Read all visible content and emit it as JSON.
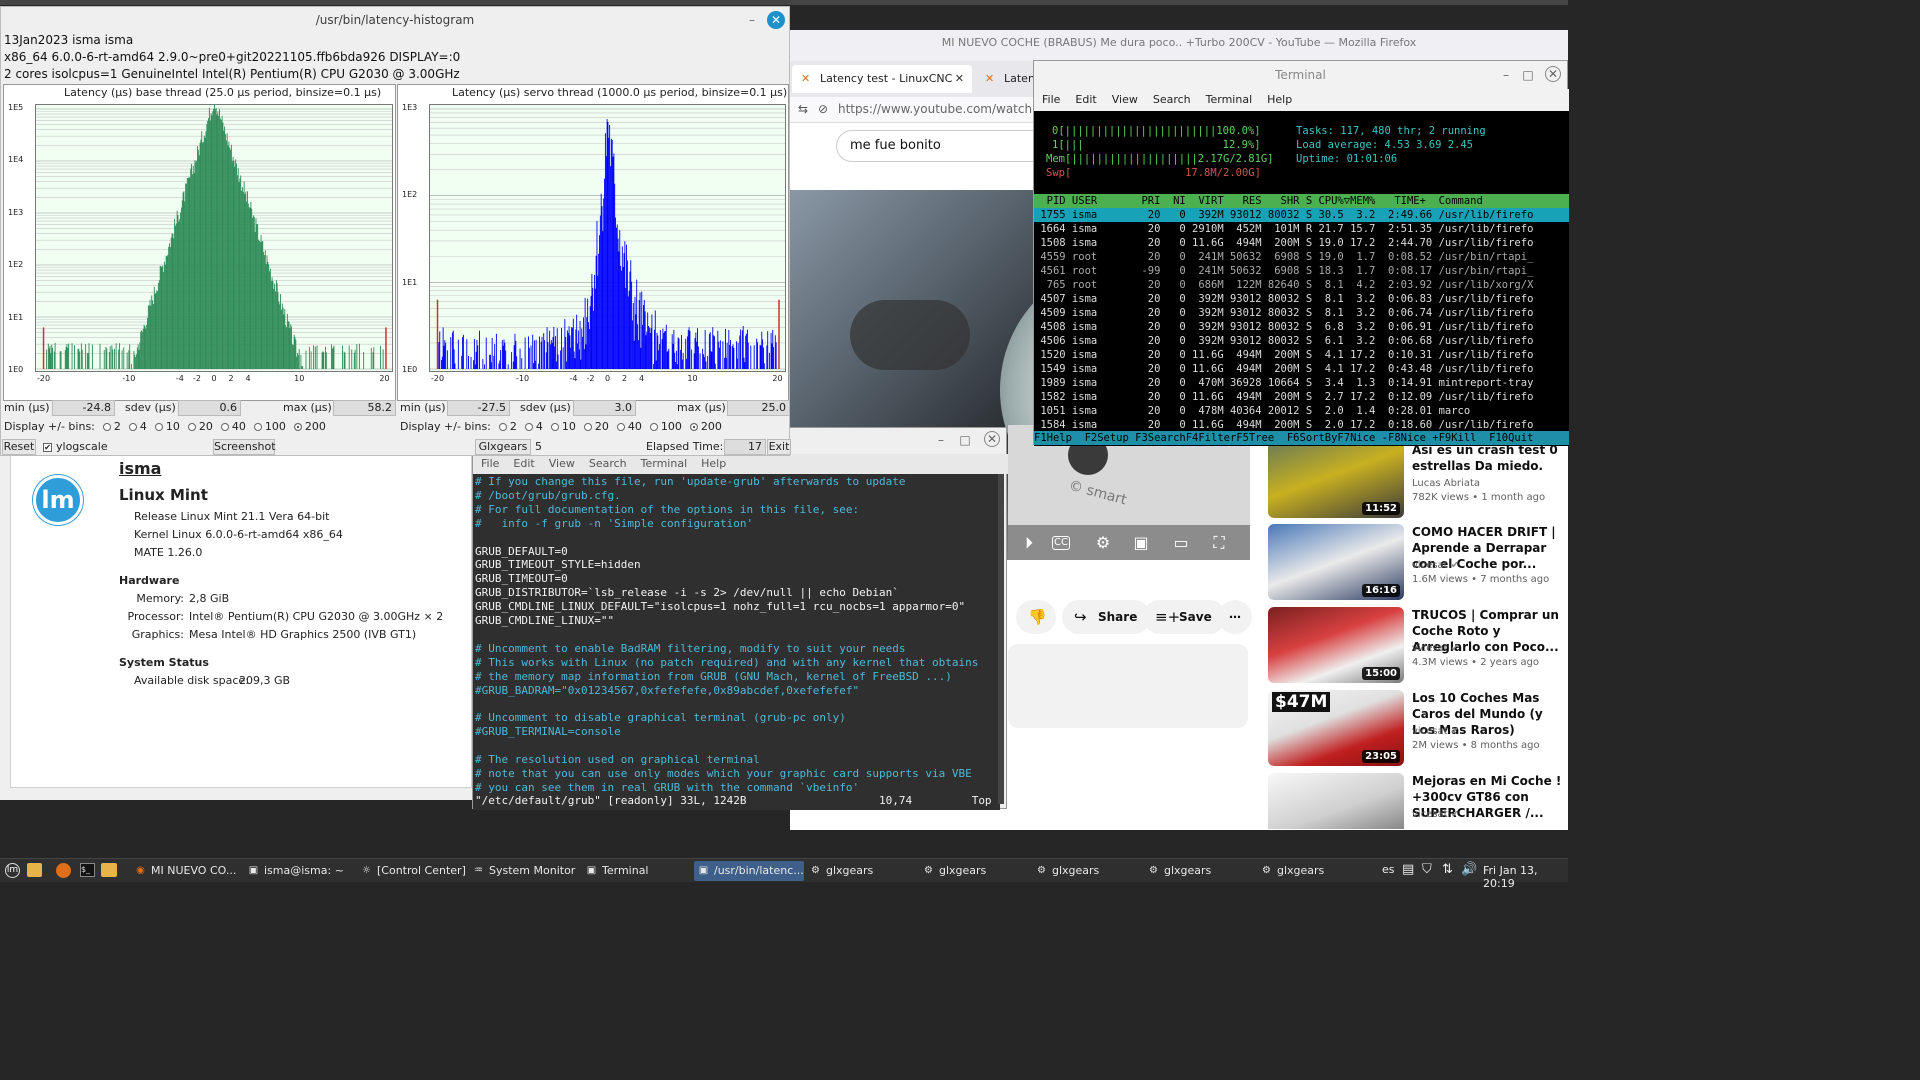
{
  "histogram_window": {
    "title": "/usr/bin/latency-histogram",
    "info_lines": [
      "13Jan2023 isma isma",
      "x86_64  6.0.0-6-rt-amd64  2.9.0~pre0+git20221105.ffb6bda926  DISPLAY=:0",
      "2 cores  isolcpus=1   GenuineIntel  Intel(R) Pentium(R) CPU G2030 @ 3.00GHz"
    ],
    "base": {
      "title": "Latency (µs) base thread (25.0 µs period, binsize=0.1 µs)",
      "yticks": [
        "1E5",
        "1E4",
        "1E3",
        "1E2",
        "1E1",
        "1E0"
      ],
      "xticks": [
        "-20",
        "-10",
        "-4",
        "-2",
        "0",
        "2",
        "4",
        "10",
        "20"
      ],
      "min_label": "min (µs)",
      "min": "-24.8",
      "sdev_label": "sdev (µs)",
      "sdev": "0.6",
      "max_label": "max (µs)",
      "max": "58.2"
    },
    "servo": {
      "title": "Latency (µs) servo thread (1000.0 µs period, binsize=0.1 µs)",
      "yticks": [
        "1E3",
        "1E2",
        "1E1",
        "1E0"
      ],
      "xticks": [
        "-20",
        "-10",
        "-4",
        "-2",
        "0",
        "2",
        "4",
        "10",
        "20"
      ],
      "min_label": "min (µs)",
      "min": "-27.5",
      "sdev_label": "sdev (µs)",
      "sdev": "3.0",
      "max_label": "max (µs)",
      "max": "25.0"
    },
    "bins_label": "Display +/- bins:",
    "bins_options": [
      "2",
      "4",
      "10",
      "20",
      "40",
      "100",
      "200"
    ],
    "bins_selected": "200",
    "reset": "Reset",
    "ylogscale": "ylogscale",
    "screenshot": "Screenshot",
    "glxgears_label": "Glxgears",
    "glxgears_value": "5",
    "elapsed_label": "Elapsed Time:",
    "elapsed_value": "17",
    "exit": "Exit",
    "base_color": "#2e8b57",
    "servo_color": "#0000ff"
  },
  "about": {
    "user": "isma",
    "distro": "Linux Mint",
    "release": "Release Linux Mint 21.1 Vera 64-bit",
    "kernel": "Kernel Linux 6.0.0-6-rt-amd64 x86_64",
    "mate": "MATE 1.26.0",
    "hardware_heading": "Hardware",
    "memory_label": "Memory:",
    "memory": "2,8 GiB",
    "processor_label": "Processor:",
    "processor": "Intel® Pentium(R) CPU G2030 @ 3.00GHz × 2",
    "graphics_label": "Graphics:",
    "graphics": "Mesa Intel® HD Graphics 2500 (IVB GT1)",
    "status_heading": "System Status",
    "disk_label": "Available disk space:",
    "disk": "209,3 GB"
  },
  "firefox": {
    "title": "MI NUEVO COCHE (BRABUS) Me dura poco.. +Turbo 200CV - YouTube — Mozilla Firefox",
    "tab1": "Latency test - LinuxCNC",
    "tab2": "Laten",
    "url": "https://www.youtube.com/watch?v=/",
    "search_value": "me fue bonito",
    "share": "Share",
    "save": "Save",
    "recs": [
      {
        "title": "Así es un crash test 0 estrellas Da miedo.",
        "channel": "Lucas Abriata",
        "meta": "782K views  •  1 month ago",
        "dur": "11:52"
      },
      {
        "title": "COMO HACER DRIFT | Aprende a Derrapar con el Coche por...",
        "channel": "vicesat",
        "meta": "1.6M views  •  7 months ago",
        "dur": "16:16"
      },
      {
        "title": "TRUCOS | Comprar un Coche Roto y Arreglarlo con Poco...",
        "channel": "vicesat",
        "meta": "4.3M views  •  2 years ago",
        "dur": "15:00"
      },
      {
        "title": "Los 10 Coches Mas Caros del Mundo (y Los Mas Raros)",
        "channel": "vicesat",
        "meta": "2M views  •  8 months ago",
        "dur": "23:05",
        "thumb_text": "$47M"
      },
      {
        "title": "Mejoras en Mi Coche ! +300cv GT86 con SUPERCHARGER /...",
        "channel": "vicesat",
        "meta": "",
        "dur": ""
      }
    ]
  },
  "htop": {
    "title": "Terminal",
    "menu": [
      "File",
      "Edit",
      "View",
      "Search",
      "Terminal",
      "Help"
    ],
    "cpu0": "0[||||||||||||||||||||||||100.0%]",
    "cpu1": "1[|||                      12.9%]",
    "mem": "Mem[||||||||||||||||||||2.17G/2.81G]",
    "swp": "Swp[                  17.8M/2.00G]",
    "tasks": "Tasks: 117, 480 thr; 2 running",
    "load": "Load average: 4.53 3.69 2.45",
    "uptime": "Uptime: 01:01:06",
    "header": "  PID USER       PRI  NI  VIRT   RES   SHR S CPU%▽MEM%   TIME+  Command",
    "rows": [
      " 1755 isma        20   0  392M 93012 80032 S 30.5  3.2  2:49.66 /usr/lib/firefo",
      " 1664 isma        20   0 2910M  452M  101M R 21.7 15.7  2:51.35 /usr/lib/firefo",
      " 1508 isma        20   0 11.6G  494M  200M S 19.0 17.2  2:44.70 /usr/lib/firefo",
      " 4559 root        20   0  241M 50632  6908 S 19.0  1.7  0:08.52 /usr/bin/rtapi_",
      " 4561 root       -99   0  241M 50632  6908 S 18.3  1.7  0:08.17 /usr/bin/rtapi_",
      "  765 root        20   0  686M  122M 82640 S  8.1  4.2  2:03.92 /usr/lib/xorg/X",
      " 4507 isma        20   0  392M 93012 80032 S  8.1  3.2  0:06.83 /usr/lib/firefo",
      " 4509 isma        20   0  392M 93012 80032 S  8.1  3.2  0:06.74 /usr/lib/firefo",
      " 4508 isma        20   0  392M 93012 80032 S  6.8  3.2  0:06.91 /usr/lib/firefo",
      " 4506 isma        20   0  392M 93012 80032 S  6.1  3.2  0:06.68 /usr/lib/firefo",
      " 1520 isma        20   0 11.6G  494M  200M S  4.1 17.2  0:10.31 /usr/lib/firefo",
      " 1549 isma        20   0 11.6G  494M  200M S  4.1 17.2  0:43.48 /usr/lib/firefo",
      " 1989 isma        20   0  470M 36928 10664 S  3.4  1.3  0:14.91 mintreport-tray",
      " 1582 isma        20   0 11.6G  494M  200M S  2.7 17.2  0:12.09 /usr/lib/firefo",
      " 1051 isma        20   0  478M 40364 20012 S  2.0  1.4  0:28.01 marco",
      " 1584 isma        20   0 11.6G  494M  200M S  2.0 17.2  0:18.60 /usr/lib/firefo"
    ],
    "footer": "F1Help  F2Setup F3SearchF4FilterF5Tree  F6SortByF7Nice -F8Nice +F9Kill  F10Quit"
  },
  "grub": {
    "menu": [
      "File",
      "Edit",
      "View",
      "Search",
      "Terminal",
      "Help"
    ],
    "lines": [
      {
        "t": "# If you change this file, run 'update-grub' afterwards to update",
        "c": "cmt"
      },
      {
        "t": "# /boot/grub/grub.cfg.",
        "c": "cmt"
      },
      {
        "t": "# For full documentation of the options in this file, see:",
        "c": "cmt"
      },
      {
        "t": "#   info -f grub -n 'Simple configuration'",
        "c": "cmt"
      },
      {
        "t": "",
        "c": "norm"
      },
      {
        "t": "GRUB_DEFAULT=0",
        "c": "norm"
      },
      {
        "t": "GRUB_TIMEOUT_STYLE=hidden",
        "c": "norm"
      },
      {
        "t": "GRUB_TIMEOUT=0",
        "c": "norm"
      },
      {
        "t": "GRUB_DISTRIBUTOR=`lsb_release -i -s 2> /dev/null || echo Debian`",
        "c": "norm"
      },
      {
        "t": "GRUB_CMDLINE_LINUX_DEFAULT=\"isolcpus=1 nohz_full=1 rcu_nocbs=1 apparmor=0\"",
        "c": "norm"
      },
      {
        "t": "GRUB_CMDLINE_LINUX=\"\"",
        "c": "norm"
      },
      {
        "t": "",
        "c": "norm"
      },
      {
        "t": "# Uncomment to enable BadRAM filtering, modify to suit your needs",
        "c": "cmt"
      },
      {
        "t": "# This works with Linux (no patch required) and with any kernel that obtains",
        "c": "cmt"
      },
      {
        "t": "# the memory map information from GRUB (GNU Mach, kernel of FreeBSD ...)",
        "c": "cmt"
      },
      {
        "t": "#GRUB_BADRAM=\"0x01234567,0xfefefefe,0x89abcdef,0xefefefef\"",
        "c": "cmt"
      },
      {
        "t": "",
        "c": "norm"
      },
      {
        "t": "# Uncomment to disable graphical terminal (grub-pc only)",
        "c": "cmt"
      },
      {
        "t": "#GRUB_TERMINAL=console",
        "c": "cmt"
      },
      {
        "t": "",
        "c": "norm"
      },
      {
        "t": "# The resolution used on graphical terminal",
        "c": "cmt"
      },
      {
        "t": "# note that you can use only modes which your graphic card supports via VBE",
        "c": "cmt"
      },
      {
        "t": "# you can see them in real GRUB with the command `vbeinfo'",
        "c": "cmt"
      },
      {
        "t": "\"/etc/default/grub\" [readonly] 33L, 1242B                    10,74         Top",
        "c": "norm"
      }
    ]
  },
  "taskbar": {
    "items": [
      "MI NUEVO CO...",
      "isma@isma: ~",
      "[Control Center]",
      "System Monitor",
      "Terminal",
      "/usr/bin/latenc...",
      "glxgears",
      "glxgears",
      "glxgears",
      "glxgears",
      "glxgears"
    ],
    "lang": "es",
    "clock": "Fri Jan 13, 20:19"
  }
}
